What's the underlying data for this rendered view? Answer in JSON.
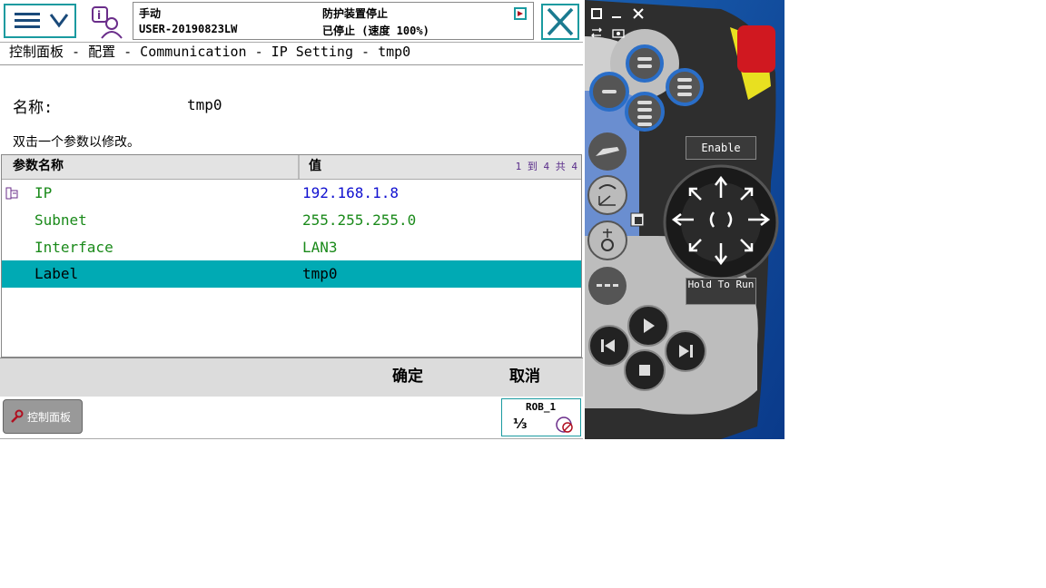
{
  "header": {
    "mode": "手动",
    "controller": "USER-20190823LW",
    "safety_status": "防护装置停止",
    "run_status": "已停止 (速度 100%)"
  },
  "breadcrumb": "控制面板 - 配置 - Communication - IP Setting - tmp0",
  "instance": {
    "name_label": "名称:",
    "name_value": "tmp0"
  },
  "instruction": "双击一个参数以修改。",
  "table": {
    "col_name": "参数名称",
    "col_value": "值",
    "count": "1 到 4 共 4",
    "rows": [
      {
        "name": "IP",
        "value": "192.168.1.8"
      },
      {
        "name": "Subnet",
        "value": "255.255.255.0"
      },
      {
        "name": "Interface",
        "value": "LAN3"
      },
      {
        "name": "Label",
        "value": "tmp0"
      }
    ]
  },
  "actions": {
    "ok": "确定",
    "cancel": "取消"
  },
  "taskbar": {
    "control_panel": "控制面板",
    "robot": "ROB_1",
    "increment": "⅓"
  },
  "pendant": {
    "enable": "Enable",
    "hold_to_run": "Hold To Run"
  },
  "colors": {
    "accent": "#1a9aa0",
    "selected_row": "#00aab4",
    "pendant_bg": "#2a6ec8"
  }
}
